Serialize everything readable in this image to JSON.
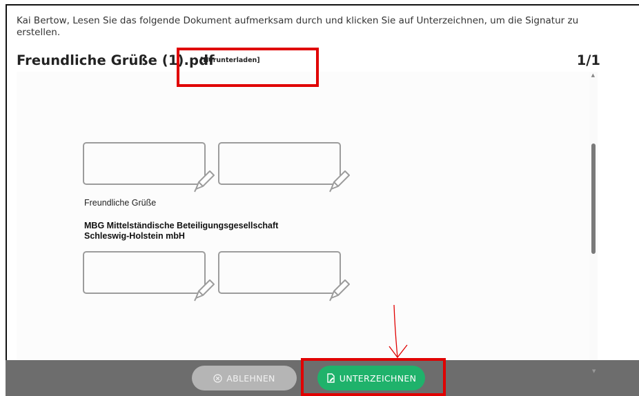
{
  "instruction": "Kai Bertow, Lesen Sie das folgende Dokument aufmerksam durch und klicken Sie auf Unterzeichnen, um die Signatur zu erstellen.",
  "document": {
    "title": "Freundliche Grüße (1).pdf",
    "download_label": "[Herunterladen]",
    "page_indicator": "1/1"
  },
  "page": {
    "greeting": "Freundliche Grüße",
    "company_line1": "MBG Mittelständische Beteiligungsgesellschaft",
    "company_line2": "Schleswig-Holstein mbH"
  },
  "footer": {
    "decline_label": "ABLEHNEN",
    "sign_label": "UNTERZEICHNEN"
  },
  "colors": {
    "sign_button": "#1fb26b",
    "decline_button": "#b5b5b5",
    "footer_bar": "#6d6d6d",
    "annotation_red": "#e00000"
  },
  "icons": {
    "decline": "circle-x-icon",
    "sign": "document-pen-icon",
    "signature_field": "pen-icon"
  }
}
